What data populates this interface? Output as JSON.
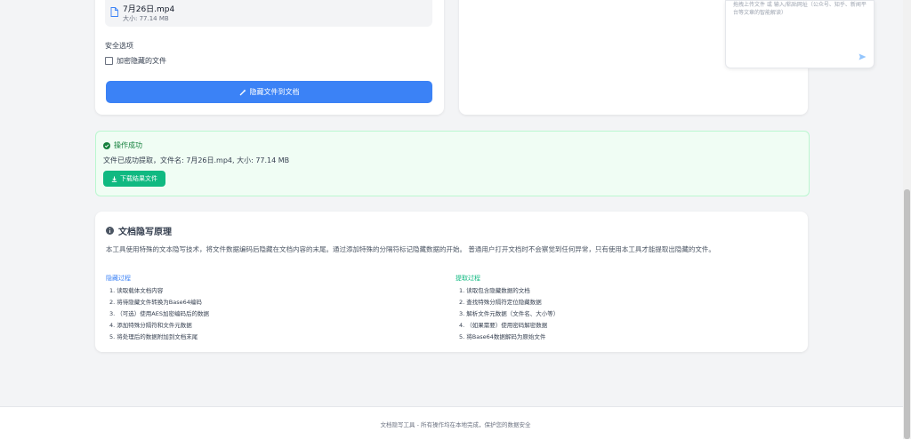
{
  "upload": {
    "file_name": "7月26日.mp4",
    "file_size": "大小: 77.14 MB",
    "security_title": "安全选项",
    "encrypt_label": "加密隐藏的文件",
    "hide_button": "隐藏文件到文档"
  },
  "chat": {
    "placeholder": "拖拽上传文件 或 输入/粘贴网址（公众号、知乎、新闻平台等文章的智能解读）"
  },
  "alert": {
    "title": "操作成功",
    "text": "文件已成功提取，文件名: 7月26日.mp4, 大小: 77.14 MB",
    "download_button": "下载结果文件"
  },
  "principle": {
    "title": "文档隐写原理",
    "description": "本工具使用特殊的文本隐写技术，将文件数据编码后隐藏在文档内容的末尾。通过添加特殊的分隔符标记隐藏数据的开始。 普通用户打开文档时不会察觉到任何异常，只有使用本工具才能提取出隐藏的文件。",
    "hide_title": "隐藏过程",
    "hide_steps": [
      "1. 读取载体文档内容",
      "2. 将待隐藏文件转换为Base64编码",
      "3. （可选）使用AES加密编码后的数据",
      "4. 添加特殊分隔符和文件元数据",
      "5. 将处理后的数据附加到文档末尾"
    ],
    "extract_title": "提取过程",
    "extract_steps": [
      "1. 读取包含隐藏数据的文档",
      "2. 查找特殊分隔符定位隐藏数据",
      "3. 解析文件元数据（文件名、大小等）",
      "4. （如果需要）使用密码解密数据",
      "5. 将Base64数据解码为原始文件"
    ]
  },
  "footer": {
    "text": "文档隐写工具 - 所有操作均在本地完成，保护您的数据安全"
  },
  "colors": {
    "primary": "#3b82f6",
    "success": "#10b981",
    "success_text": "#15803d",
    "hide_title": "#3b82f6",
    "extract_title": "#10b981"
  }
}
